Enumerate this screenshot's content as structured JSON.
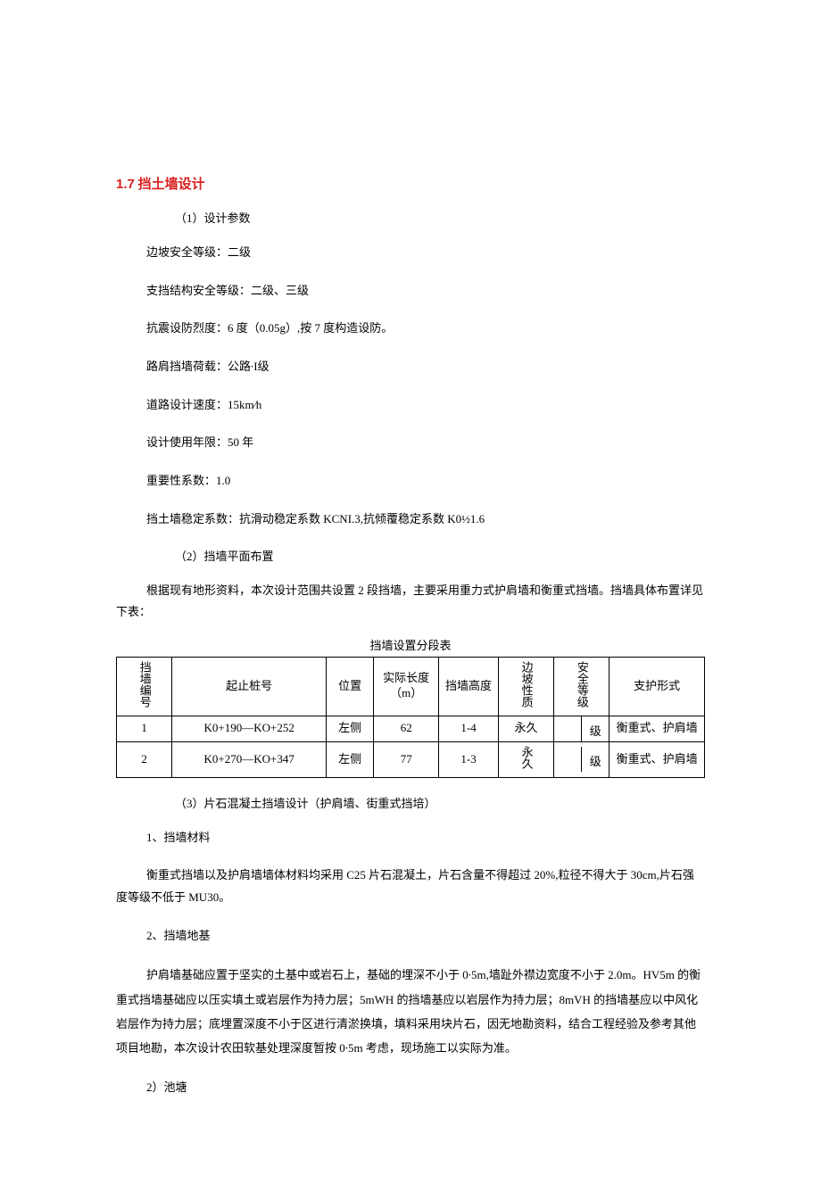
{
  "heading": {
    "number": "1.7",
    "title": "挡土墙设计"
  },
  "design_params": {
    "label": "（1）设计参数",
    "items": [
      "边坡安全等级：二级",
      "支挡结构安全等级：二级、三级",
      "抗震设防烈度：6 度（0.05g）,按 7 度构造设防。",
      "路肩挡墙荷载：公路∙I级",
      "道路设计速度：15km∕h",
      "设计使用年限：50 年",
      "重要性系数：1.0",
      "挡土墙稳定系数：抗滑动稳定系数 KCNI.3,抗倾覆稳定系数 K0½1.6"
    ]
  },
  "layout": {
    "label": "（2）挡墙平面布置",
    "text": "根据现有地形资料，本次设计范围共设置 2 段挡墙，主要采用重力式护肩墙和衡重式挡墙。挡墙具体布置详见下表："
  },
  "table": {
    "title": "挡墙设置分段表",
    "headers": {
      "id": "挡墙编号",
      "range": "起止桩号",
      "location": "位置",
      "length": "实际长度（m）",
      "height": "挡墙高度",
      "nature": "边坡性质",
      "safety": "安全等级",
      "form": "支护形式"
    },
    "rows": [
      {
        "id": "1",
        "range": "K0+190—KO+252",
        "location": "左侧",
        "length": "62",
        "height": "1-4",
        "nature": "永久",
        "safety": "级",
        "form": "衡重式、护肩墙"
      },
      {
        "id": "2",
        "range": "K0+270—KO+347",
        "location": "左侧",
        "length": "77",
        "height": "1-3",
        "nature": "永久",
        "safety": "级",
        "form": "衡重式、护肩墙"
      }
    ]
  },
  "sec3": {
    "label": "（3）片石混凝土挡墙设计（护肩墙、街重式挡培）",
    "material_label": "1、挡墙材料",
    "material_text": "衡重式挡墙以及护肩墙墙体材料均采用 C25 片石混凝土，片石含量不得超过 20%,粒径不得大于 30cm,片石强度等级不低于 MU30。",
    "foundation_label": "2、挡墙地基",
    "foundation_text": "护肩墙基础应置于坚实的土基中或岩石上，基础的埋深不小于 0∙5m,墙趾外襟边宽度不小于 2.0m。HV5m 的衡重式挡墙基础应以压实填土或岩层作为持力层；5mWH 的挡墙基应以岩层作为持力层；8mVH 的挡墙基应以中风化岩层作为持力层；底埋置深度不小于区进行清淤换填，填料采用块片石，因无地勘资料，结合工程经验及参考其他项目地勘，本次设计农田软基处理深度暂按 0∙5m 考虑，现场施工以实际为准。",
    "pond_label": "2）池塘"
  }
}
